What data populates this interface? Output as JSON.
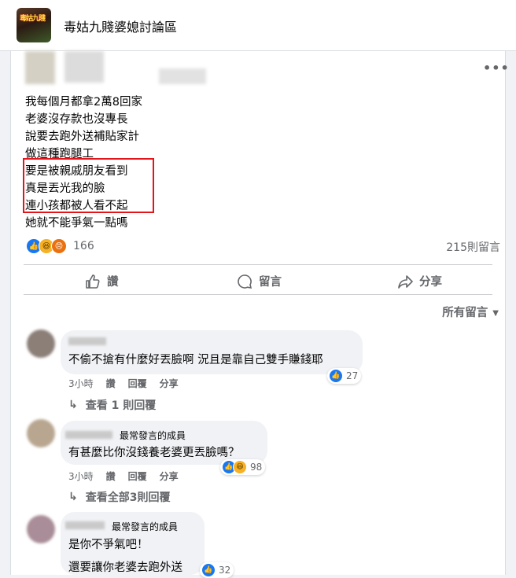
{
  "group": {
    "title": "毒姑九賤婆媳討論區",
    "avatar_badge": "毒姑九賤"
  },
  "post": {
    "lines": [
      "我每個月都拿2萬8回家",
      "老婆沒存款也沒專長",
      "說要去跑外送補貼家計",
      "做這種跑腿工",
      "要是被親戚朋友看到",
      "真是丟光我的臉",
      "連小孩都被人看不起",
      "她就不能爭氣一點嗎"
    ],
    "reaction_count": "166",
    "comment_total": "215則留言",
    "actions": {
      "like": "讚",
      "comment": "留言",
      "share": "分享"
    },
    "sort_label": "所有留言"
  },
  "comments": [
    {
      "text": "不偷不搶有什麼好丟臉啊 況且是靠自己雙手賺錢耶",
      "time": "3小時",
      "like": "讚",
      "reply": "回覆",
      "share": "分享",
      "reactions": "27",
      "replies": "查看 1 則回覆"
    },
    {
      "badge": "最常發言的成員",
      "text": "有甚麼比你沒錢養老婆更丟臉嗎？",
      "time": "3小時",
      "like": "讚",
      "reply": "回覆",
      "share": "分享",
      "reactions": "98",
      "replies": "查看全部3則回覆"
    },
    {
      "badge": "最常發言的成員",
      "text": "是你不爭氣吧！",
      "text2": "還要讓你老婆去跑外送",
      "reactions": "32"
    }
  ],
  "colors": {
    "accent": "#1877f2",
    "highlight": "#e4141b",
    "muted": "#65676b"
  }
}
